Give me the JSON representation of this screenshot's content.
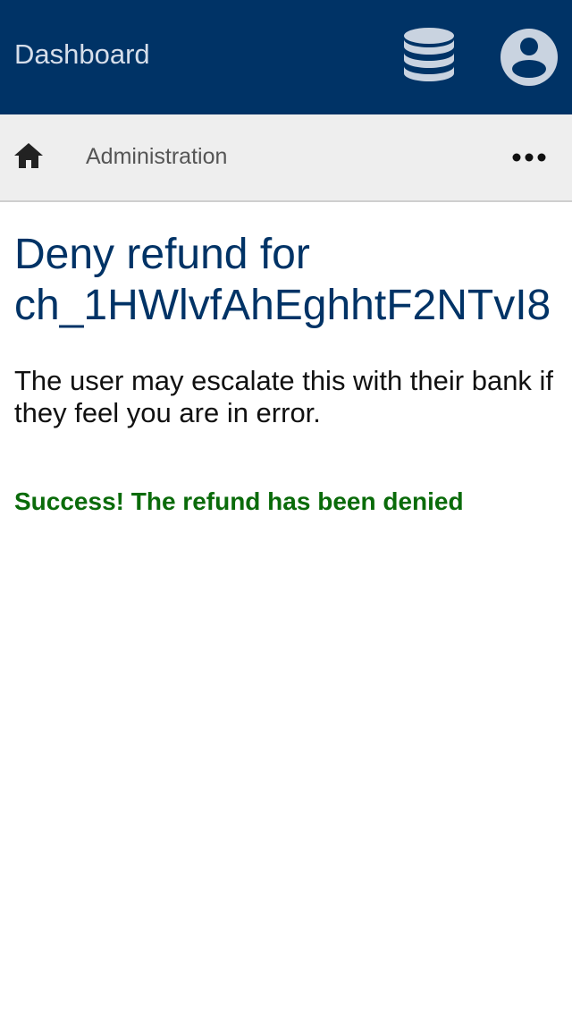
{
  "header": {
    "title": "Dashboard",
    "icons": [
      "database-icon",
      "user-account-icon"
    ],
    "background_color": "#003366"
  },
  "subnav": {
    "home_icon": "home-icon",
    "breadcrumb": "Administration",
    "more_icon": "more-horizontal-icon"
  },
  "main": {
    "heading_line1": "Deny refund for",
    "heading_line2": "ch_1HWlvfAhEghhtF2NTvI8",
    "description": "The user may escalate this with their bank if they feel you are in error.",
    "success_message": "Success! The refund has been denied",
    "success_color": "#0a6b0a"
  }
}
